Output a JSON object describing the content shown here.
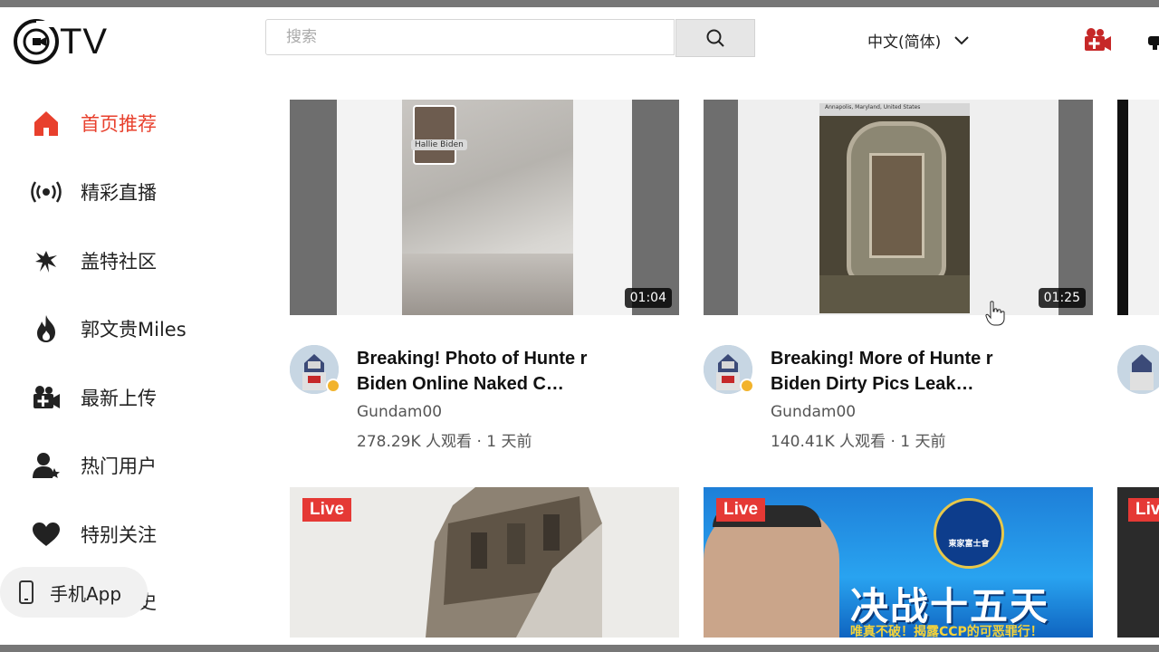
{
  "header": {
    "logo_text": "TV",
    "search_placeholder": "搜索",
    "language": "中文(简体)"
  },
  "sidebar": {
    "items": [
      {
        "label": "首页推荐",
        "icon": "home-icon",
        "active": true
      },
      {
        "label": "精彩直播",
        "icon": "live-broadcast-icon"
      },
      {
        "label": "盖特社区",
        "icon": "eagle-icon"
      },
      {
        "label": "郭文贵Miles",
        "icon": "flame-icon"
      },
      {
        "label": "最新上传",
        "icon": "video-upload-icon"
      },
      {
        "label": "热门用户",
        "icon": "user-star-icon"
      },
      {
        "label": "特别关注",
        "icon": "heart-icon"
      },
      {
        "label": "史",
        "icon": "history-icon"
      }
    ],
    "app_label": "手机App"
  },
  "videos": [
    {
      "title": "Breaking! Photo of Hunte r Biden Online Naked C…",
      "author": "Gundam00",
      "meta": "278.29K 人观看 · 1 天前",
      "duration": "01:04",
      "overlay_text": "Hallie Biden"
    },
    {
      "title": "Breaking! More of Hunte r Biden Dirty Pics Leak…",
      "author": "Gundam00",
      "meta": "140.41K 人观看 · 1 天前",
      "duration": "01:25",
      "overlay_text": "Annapolis, Maryland, United States"
    }
  ],
  "live_cards": [
    {
      "badge": "Live"
    },
    {
      "badge": "Live",
      "banner_text": "决战十五天",
      "banner_sub": "唯真不破！揭露CCP的可恶罪行！",
      "seal_text": "東家富士會"
    }
  ],
  "partial_live_badge": "Liv",
  "colors": {
    "accent": "#e8402d",
    "live": "#e53935"
  }
}
